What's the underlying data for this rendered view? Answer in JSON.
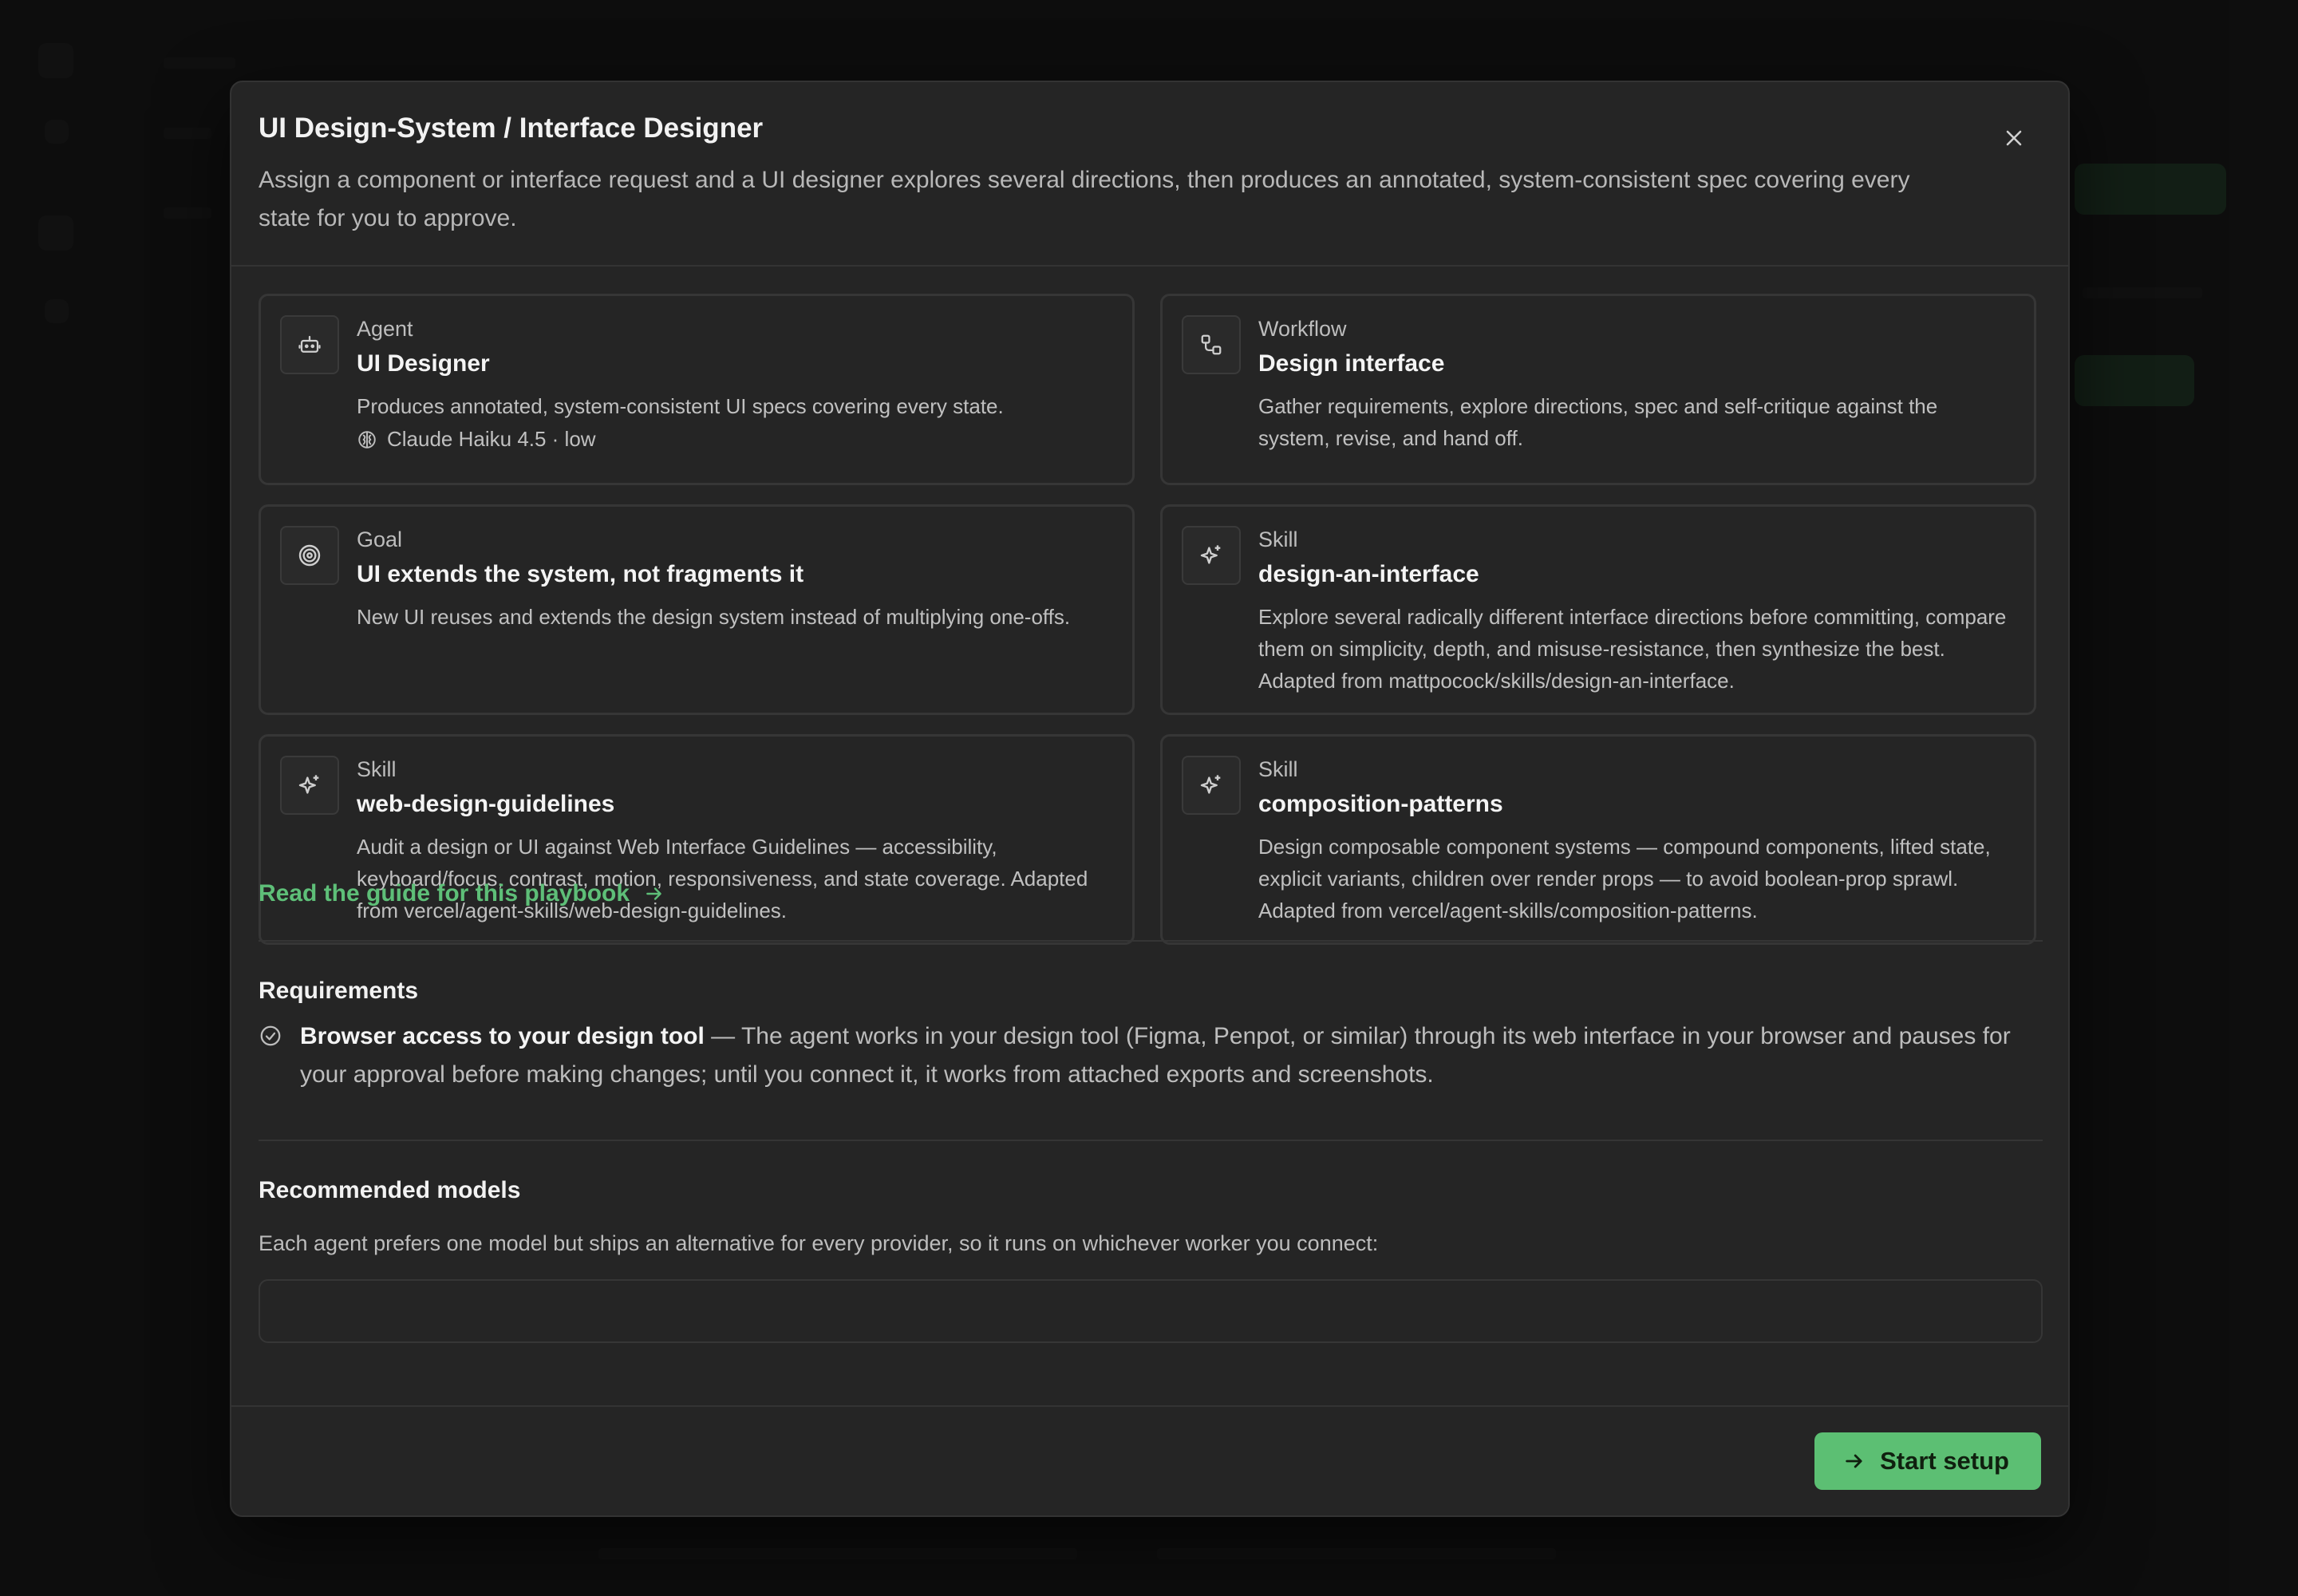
{
  "modal": {
    "title": "UI Design-System / Interface Designer",
    "subtitle": "Assign a component or interface request and a UI designer explores several directions, then produces an annotated, system-consistent spec covering every state for you to approve.",
    "close_icon": "close-icon"
  },
  "cards": [
    {
      "kind": "Agent",
      "title": "UI Designer",
      "description": "Produces annotated, system-consistent UI specs covering every state.",
      "meta": "Claude Haiku 4.5 · low",
      "icon": "robot-icon",
      "meta_icon": "brain-icon"
    },
    {
      "kind": "Workflow",
      "title": "Design interface",
      "description": "Gather requirements, explore directions, spec and self-critique against the system, revise, and hand off.",
      "icon": "workflow-icon"
    },
    {
      "kind": "Goal",
      "title": "UI extends the system, not fragments it",
      "description": "New UI reuses and extends the design system instead of multiplying one-offs.",
      "icon": "target-icon"
    },
    {
      "kind": "Skill",
      "title": "design-an-interface",
      "description": "Explore several radically different interface directions before committing, compare them on simplicity, depth, and misuse-resistance, then synthesize the best. Adapted from mattpocock/skills/design-an-interface.",
      "icon": "sparkle-icon"
    },
    {
      "kind": "Skill",
      "title": "web-design-guidelines",
      "description": "Audit a design or UI against Web Interface Guidelines — accessibility, keyboard/focus, contrast, motion, responsiveness, and state coverage. Adapted from vercel/agent-skills/web-design-guidelines.",
      "icon": "sparkle-icon"
    },
    {
      "kind": "Skill",
      "title": "composition-patterns",
      "description": "Design composable component systems — compound components, lifted state, explicit variants, children over render props — to avoid boolean-prop sprawl. Adapted from vercel/agent-skills/composition-patterns.",
      "icon": "sparkle-icon"
    }
  ],
  "guide_link": "Read the guide for this playbook",
  "requirements": {
    "title": "Requirements",
    "items": [
      {
        "name": "Browser access to your design tool",
        "text": " — The agent works in your design tool (Figma, Penpot, or similar) through its web interface in your browser and pauses for your approval before making changes; until you connect it, it works from attached exports and screenshots."
      }
    ]
  },
  "recommended": {
    "title": "Recommended models",
    "description": "Each agent prefers one model but ships an alternative for every provider, so it runs on whichever worker you connect:"
  },
  "footer": {
    "start_label": "Start setup"
  },
  "colors": {
    "accent": "#5cbf73",
    "link": "#5ebf78",
    "surface": "#252525",
    "border": "#363636"
  }
}
